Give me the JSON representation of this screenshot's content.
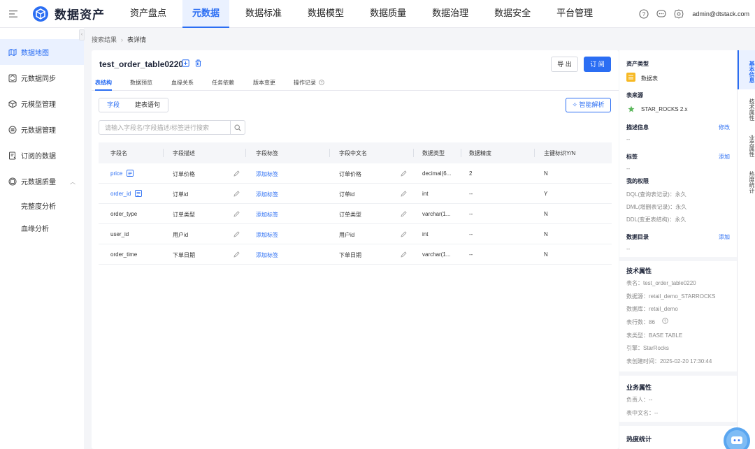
{
  "app": {
    "name": "数据资产",
    "user": "admin@dtstack.com"
  },
  "nav": [
    "资产盘点",
    "元数据",
    "数据标准",
    "数据模型",
    "数据质量",
    "数据治理",
    "数据安全",
    "平台管理"
  ],
  "nav_active": 1,
  "sidebar": {
    "items": [
      {
        "label": "数据地图",
        "icon": "map-icon"
      },
      {
        "label": "元数据同步",
        "icon": "sync-icon"
      },
      {
        "label": "元模型管理",
        "icon": "cube-icon"
      },
      {
        "label": "元数据管理",
        "icon": "database-icon"
      },
      {
        "label": "订阅的数据",
        "icon": "subscribe-icon"
      },
      {
        "label": "元数据质量",
        "icon": "quality-icon"
      }
    ],
    "subitems": [
      "完整度分析",
      "血缘分析"
    ]
  },
  "breadcrumb": {
    "parent": "搜索结果",
    "current": "表详情"
  },
  "table_title": "test_order_table0220",
  "actions": {
    "export": "导 出",
    "subscribe": "订 阅"
  },
  "tabs": [
    "表结构",
    "数据预览",
    "血缘关系",
    "任务依赖",
    "版本变更",
    "操作记录"
  ],
  "segment": [
    "字段",
    "建表语句"
  ],
  "ai_button": "智能解析",
  "search": {
    "placeholder": "请输入字段名/字段描述/标签进行搜索"
  },
  "columns": [
    "字段名",
    "字段描述",
    "字段标签",
    "字段中文名",
    "数据类型",
    "数据精度",
    "主键标识Y/N"
  ],
  "rows": [
    {
      "name": "price",
      "desc": "订单价格",
      "tag": "添加标签",
      "cn": "订单价格",
      "type": "decimal(6...",
      "precision": "2",
      "pk": "N",
      "link": true
    },
    {
      "name": "order_id",
      "desc": "订单id",
      "tag": "添加标签",
      "cn": "订单id",
      "type": "int",
      "precision": "--",
      "pk": "Y",
      "link": true
    },
    {
      "name": "order_type",
      "desc": "订单类型",
      "tag": "添加标签",
      "cn": "订单类型",
      "type": "varchar(1...",
      "precision": "--",
      "pk": "N",
      "link": false
    },
    {
      "name": "user_id",
      "desc": "用户id",
      "tag": "添加标签",
      "cn": "用户id",
      "type": "int",
      "precision": "--",
      "pk": "N",
      "link": false
    },
    {
      "name": "order_time",
      "desc": "下单日期",
      "tag": "添加标签",
      "cn": "下单日期",
      "type": "varchar(1...",
      "precision": "--",
      "pk": "N",
      "link": false
    }
  ],
  "right_panel": {
    "asset_type_label": "资产类型",
    "asset_type": "数据表",
    "source_label": "表来源",
    "source": "STAR_ROCKS 2.x",
    "desc_label": "描述信息",
    "desc_action": "修改",
    "desc_value": "--",
    "tag_label": "标签",
    "tag_action": "添加",
    "tag_value": "--",
    "perm_label": "我的权限",
    "perms": [
      "DQL(查询表记录)：永久",
      "DML(增删表记录)：永久",
      "DDL(变更表结构)：永久"
    ],
    "catalog_label": "数据目录",
    "catalog_action": "添加",
    "catalog_value": "--",
    "tech_title": "技术属性",
    "tech": [
      "表名：test_order_table0220",
      "数据源：retail_demo_STARROCKS",
      "数据库：retail_demo",
      "表行数：86",
      "表类型：BASE TABLE",
      "引擎：StarRocks",
      "表创建时间：2025-02-20 17:30:44"
    ],
    "biz_title": "业务属性",
    "biz": [
      "负责人：--",
      "表中文名：--"
    ],
    "heat_title": "热度统计"
  },
  "right_tabs": [
    "基本信息",
    "技术属性",
    "业务属性",
    "热度统计"
  ],
  "colors": {
    "accent": "#2b6ef3",
    "active_bg": "#eaf1ff"
  }
}
